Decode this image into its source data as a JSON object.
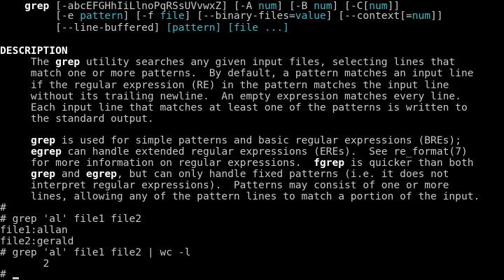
{
  "synopsis": {
    "line1": {
      "indent": "    ",
      "cmd": "grep",
      "t1": " [-abcEFGHhIiLlnoPqRSsUVvwxZ] [-A ",
      "num1": "num",
      "t2": "] [-B ",
      "num2": "num",
      "t3": "] [-C[",
      "num3": "num",
      "t4": "]]"
    },
    "line2": {
      "indent": "         ",
      "t1": "[-e ",
      "pattern": "pattern",
      "t2": "] [-f ",
      "file": "file",
      "t3": "] [--binary-files=",
      "value": "value",
      "t4": "] [--context[=",
      "num": "num",
      "t5": "]]"
    },
    "line3": {
      "indent": "         ",
      "t1": "[--line-buffered] ",
      "pattern": "[pattern]",
      "t2": " ",
      "file": "[file ...]"
    }
  },
  "description": {
    "heading": "DESCRIPTION",
    "p1": {
      "l1_pre": "     The ",
      "l1_cmd": "grep",
      "l1_post": " utility searches any given input files, selecting lines that",
      "l2": "     match one or more patterns.  By default, a pattern matches an input line",
      "l3": "     if the regular expression (RE) in the pattern matches the input line",
      "l4": "     without its trailing newline.  An empty expression matches every line.",
      "l5": "     Each input line that matches at least one of the patterns is written to",
      "l6": "     the standard output."
    },
    "p2": {
      "l1_indent": "     ",
      "l1_cmd": "grep",
      "l1_post": " is used for simple patterns and basic regular expressions (BREs);",
      "l2_indent": "     ",
      "l2_cmd": "egrep",
      "l2_post": " can handle extended regular expressions (EREs).  See re_format(7)",
      "l3_pre": "     for more information on regular expressions.  ",
      "l3_cmd": "fgrep",
      "l3_post": " is quicker than both",
      "l4_indent": "     ",
      "l4_cmd1": "grep",
      "l4_mid": " and ",
      "l4_cmd2": "egrep",
      "l4_post": ", but can only handle fixed patterns (i.e. it does not",
      "l5": "     interpret regular expressions).  Patterns may consist of one or more",
      "l6": "     lines, allowing any of the pattern lines to match a portion of the input."
    }
  },
  "shell": {
    "l1": "#",
    "l2": "# grep 'al' file1 file2",
    "l3": "file1:allan",
    "l4": "file2:gerald",
    "l5": "# grep 'al' file1 file2 | wc -l",
    "l6": "       2",
    "l7": "#",
    "prompt": "# "
  }
}
